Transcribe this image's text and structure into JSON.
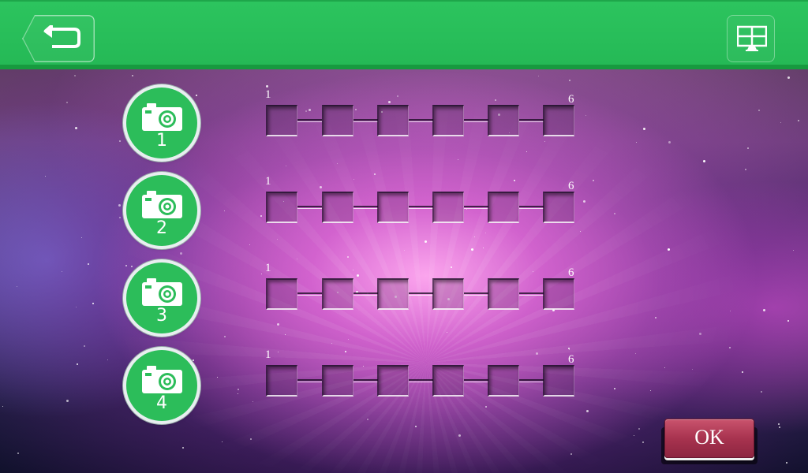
{
  "header": {
    "back_icon": "back-arrow-icon",
    "menu_icon": "grid-screen-icon"
  },
  "cameras": [
    {
      "label": "1",
      "icon": "camera-icon"
    },
    {
      "label": "2",
      "icon": "camera-icon"
    },
    {
      "label": "3",
      "icon": "camera-icon"
    },
    {
      "label": "4",
      "icon": "camera-icon"
    }
  ],
  "rows": [
    {
      "start": "1",
      "end": "6"
    },
    {
      "start": "1",
      "end": "6"
    },
    {
      "start": "1",
      "end": "6"
    },
    {
      "start": "1",
      "end": "6"
    }
  ],
  "ok_label": "OK",
  "colors": {
    "header_green": "#2cc45e",
    "camera_green": "#2cbd5a",
    "ok_button": "#a8334f"
  }
}
